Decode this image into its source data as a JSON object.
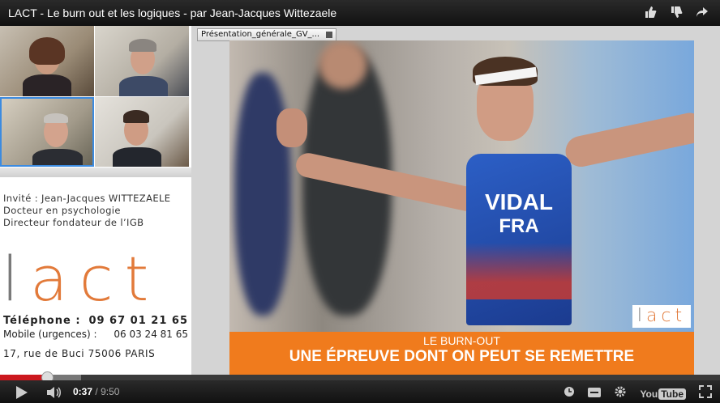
{
  "player": {
    "title": "LACT - Le burn out et les logiques - par Jean-Jacques Wittezaele",
    "progress_fraction": 0.065,
    "current_time": "0:37",
    "separator": "/",
    "duration": "9:50"
  },
  "sidebar": {
    "guest_line1": "Invité : Jean-Jacques WITTEZAELE",
    "guest_line2": "Docteur en psychologie",
    "guest_line3": "Directeur fondateur de l’IGB",
    "logo_l": "l",
    "logo_rest": "act",
    "phone_label": "Téléphone :",
    "phone_value": "09 67 01 21 65",
    "mobile_label": "Mobile (urgences) :",
    "mobile_value": "06 03 24 81 65",
    "address": "17, rue de Buci 75006 PARIS"
  },
  "presentation": {
    "tab_label": "Présentation_générale_GV_...",
    "jersey_line1": "VIDAL",
    "jersey_line2": "FRA",
    "badge_l": "l",
    "badge_rest": "act",
    "banner_line1": "LE BURN-OUT",
    "banner_line2": "UNE ÉPREUVE DONT ON PEUT SE REMETTRE"
  },
  "controls": {
    "youtube_logo_you": "You",
    "youtube_logo_tube": "Tube"
  },
  "colors": {
    "accent_orange": "#f07b1d",
    "progress_red": "#cc181e",
    "selected_cam_border": "#3c8be0"
  }
}
